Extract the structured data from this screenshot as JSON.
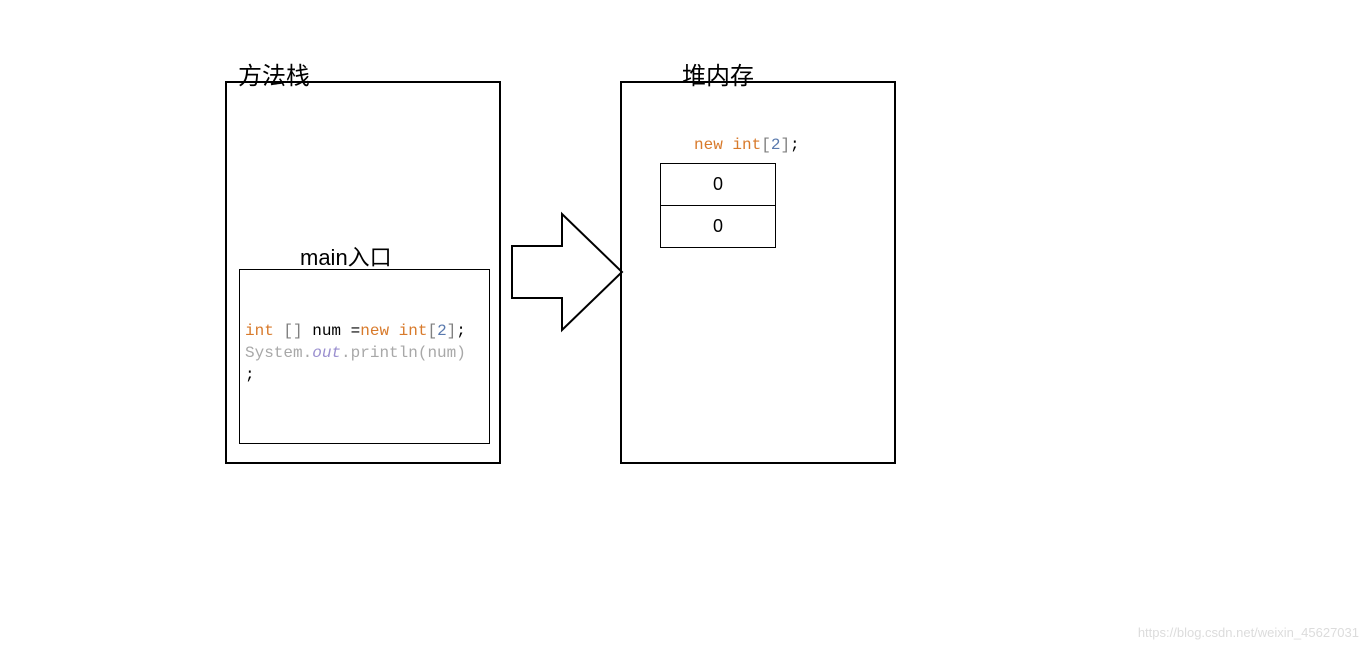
{
  "stack": {
    "title": "方法栈",
    "main_label": "main入口",
    "code": {
      "line1_int": "int",
      "line1_brackets": " [] ",
      "line1_num": "num ",
      "line1_eq": "=",
      "line1_new": "new ",
      "line1_int2": "int",
      "line1_open": "[",
      "line1_two": "2",
      "line1_close": "]",
      "line1_semi": ";",
      "line2_system": "System.",
      "line2_out": "out",
      "line2_println": ".println(num)",
      "line3_semi": ";"
    }
  },
  "heap": {
    "title": "堆内存",
    "code": {
      "new": "new ",
      "int": "int",
      "open": "[",
      "two": "2",
      "close": "]",
      "semi": ";"
    },
    "array": [
      "0",
      "0"
    ]
  },
  "watermark": "https://blog.csdn.net/weixin_45627031"
}
